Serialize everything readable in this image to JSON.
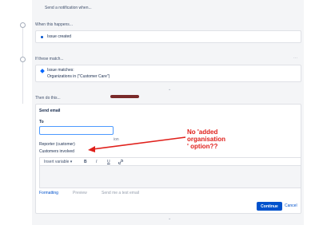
{
  "header": {
    "trigger_hint": "Send a notification when..."
  },
  "when_section": {
    "title": "When this happens...",
    "item": "Issue created"
  },
  "if_section": {
    "title": "If these match...",
    "item_title": "Issue matches:",
    "item_value": "Organizations in (\"Customer Care\")",
    "more": "···"
  },
  "then_section": {
    "title": "Then do this..."
  },
  "send_email": {
    "title": "Send email",
    "to_label": "To",
    "dropdown_options": [
      "Reporter (customer)",
      "Customers involved"
    ],
    "stray_text": "ion",
    "toolbar": {
      "insert_variable": "Insert variable",
      "bold": "B",
      "italic": "I",
      "underline": "U"
    },
    "tabs": {
      "formatting": "Formatting",
      "preview": "Preview",
      "send_test": "Send me a test email"
    },
    "continue_label": "Continue",
    "cancel_label": "Cancel"
  },
  "annotation": {
    "line1": "No 'added",
    "line2": "organisation",
    "line3": "' option??",
    "color": "#e0201b"
  },
  "colors": {
    "accent": "#0052cc",
    "panel_bg": "#f4f5f7",
    "border": "#dfe1e6"
  }
}
